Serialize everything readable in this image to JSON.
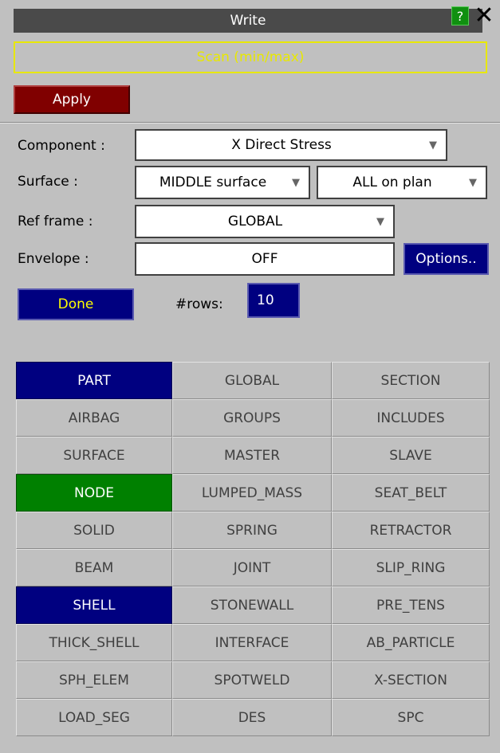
{
  "window": {
    "title": "Write",
    "help_label": "?",
    "close_label": "✕"
  },
  "scan_label": "Scan (min/max)",
  "apply_label": "Apply",
  "form": {
    "component": {
      "label": "Component :",
      "value": "X Direct Stress"
    },
    "surface": {
      "label": "Surface :",
      "value": "MIDDLE surface",
      "value2": "ALL on plan"
    },
    "ref_frame": {
      "label": "Ref frame :",
      "value": "GLOBAL"
    },
    "envelope": {
      "label": "Envelope :",
      "value": "OFF",
      "options_label": "Options.."
    }
  },
  "done_label": "Done",
  "rows": {
    "label": "#rows:",
    "value": "10"
  },
  "colors": {
    "selected_blue": "#000080",
    "selected_green": "#008000",
    "apply_red": "#800000"
  },
  "entity_grid": [
    {
      "label": "PART",
      "state": "blue"
    },
    {
      "label": "GLOBAL",
      "state": ""
    },
    {
      "label": "SECTION",
      "state": ""
    },
    {
      "label": "AIRBAG",
      "state": ""
    },
    {
      "label": "GROUPS",
      "state": ""
    },
    {
      "label": "INCLUDES",
      "state": ""
    },
    {
      "label": "SURFACE",
      "state": ""
    },
    {
      "label": "MASTER",
      "state": ""
    },
    {
      "label": "SLAVE",
      "state": ""
    },
    {
      "label": "NODE",
      "state": "green"
    },
    {
      "label": "LUMPED_MASS",
      "state": ""
    },
    {
      "label": "SEAT_BELT",
      "state": ""
    },
    {
      "label": "SOLID",
      "state": ""
    },
    {
      "label": "SPRING",
      "state": ""
    },
    {
      "label": "RETRACTOR",
      "state": ""
    },
    {
      "label": "BEAM",
      "state": ""
    },
    {
      "label": "JOINT",
      "state": ""
    },
    {
      "label": "SLIP_RING",
      "state": ""
    },
    {
      "label": "SHELL",
      "state": "blue"
    },
    {
      "label": "STONEWALL",
      "state": ""
    },
    {
      "label": "PRE_TENS",
      "state": ""
    },
    {
      "label": "THICK_SHELL",
      "state": ""
    },
    {
      "label": "INTERFACE",
      "state": ""
    },
    {
      "label": "AB_PARTICLE",
      "state": ""
    },
    {
      "label": "SPH_ELEM",
      "state": ""
    },
    {
      "label": "SPOTWELD",
      "state": ""
    },
    {
      "label": "X-SECTION",
      "state": ""
    },
    {
      "label": "LOAD_SEG",
      "state": ""
    },
    {
      "label": "DES",
      "state": ""
    },
    {
      "label": "SPC",
      "state": ""
    }
  ]
}
